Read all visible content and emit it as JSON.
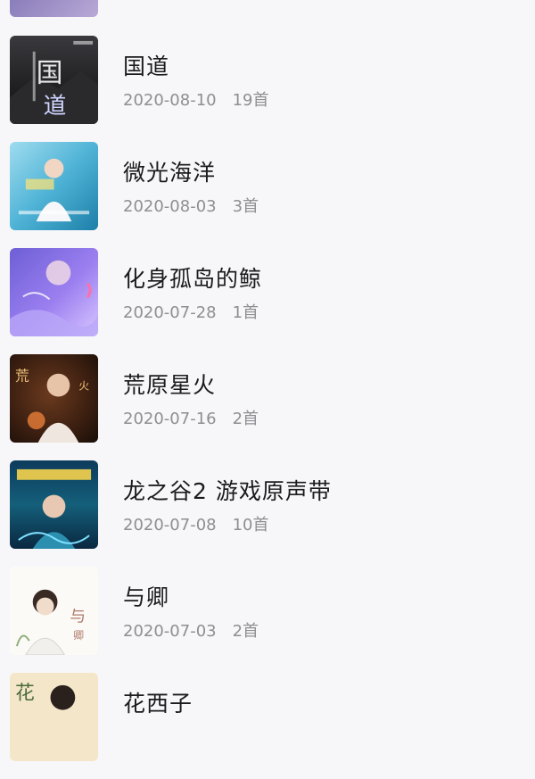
{
  "albums": [
    {
      "title": "",
      "date": "",
      "count": ""
    },
    {
      "title": "国道",
      "date": "2020-08-10",
      "count": "19首"
    },
    {
      "title": "微光海洋",
      "date": "2020-08-03",
      "count": "3首"
    },
    {
      "title": "化身孤岛的鲸",
      "date": "2020-07-28",
      "count": "1首"
    },
    {
      "title": "荒原星火",
      "date": "2020-07-16",
      "count": "2首"
    },
    {
      "title": "龙之谷2 游戏原声带",
      "date": "2020-07-08",
      "count": "10首"
    },
    {
      "title": "与卿",
      "date": "2020-07-03",
      "count": "2首"
    },
    {
      "title": "花西子",
      "date": "",
      "count": ""
    }
  ],
  "colors": {
    "background": "#f7f7f9",
    "title": "#1b1b1f",
    "meta": "#8e8e93"
  }
}
